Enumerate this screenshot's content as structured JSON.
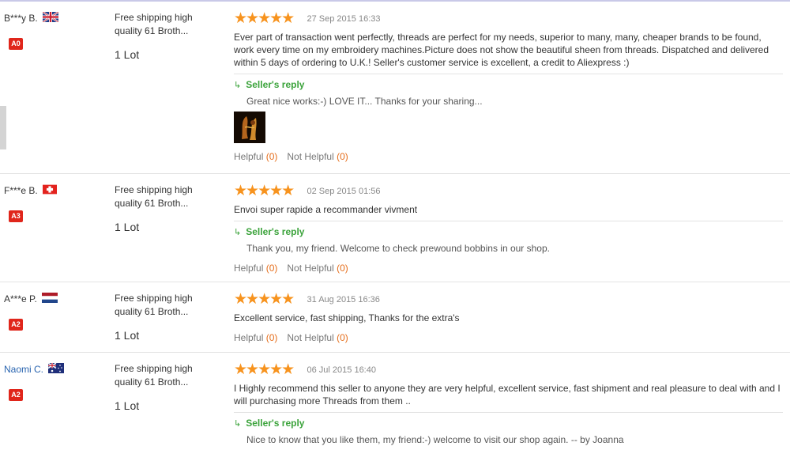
{
  "reviews": [
    {
      "user": "B***y B.",
      "flag": "uk-flag-icon",
      "level": "A0",
      "product": "Free shipping high quality 61 Broth...",
      "quantity": "1 Lot",
      "stars": 5,
      "date": "27 Sep 2015 16:33",
      "comment": "Ever part of transaction went perfectly, threads are perfect for my needs, superior to many, many, cheaper brands to be found, work every time on my embroidery machines.Picture does not show the beautiful sheen from threads. Dispatched and delivered within 5 days of ordering to U.K.! Seller's customer service is excellent, a credit to Aliexpress :)",
      "reply_label": "Seller's reply",
      "reply": "Great nice works:-) LOVE IT... Thanks for your sharing...",
      "helpful_label": "Helpful",
      "helpful_count": "(0)",
      "not_helpful_label": "Not Helpful",
      "not_helpful_count": "(0)"
    },
    {
      "user": "F***e B.",
      "flag": "swiss-flag-icon",
      "level": "A3",
      "product": "Free shipping high quality 61 Broth...",
      "quantity": "1 Lot",
      "stars": 5,
      "date": "02 Sep 2015 01:56",
      "comment": "Envoi super rapide a recommander vivment",
      "reply_label": "Seller's reply",
      "reply": "Thank you, my friend. Welcome to check prewound bobbins in our shop.",
      "helpful_label": "Helpful",
      "helpful_count": "(0)",
      "not_helpful_label": "Not Helpful",
      "not_helpful_count": "(0)"
    },
    {
      "user": "A***e P.",
      "flag": "netherlands-flag-icon",
      "level": "A2",
      "product": "Free shipping high quality 61 Broth...",
      "quantity": "1 Lot",
      "stars": 5,
      "date": "31 Aug 2015 16:36",
      "comment": "Excellent service, fast shipping, Thanks for the extra's",
      "helpful_label": "Helpful",
      "helpful_count": "(0)",
      "not_helpful_label": "Not Helpful",
      "not_helpful_count": "(0)"
    },
    {
      "user": "Naomi C.",
      "flag": "australia-flag-icon",
      "level": "A2",
      "product": "Free shipping high quality 61 Broth...",
      "quantity": "1 Lot",
      "stars": 5,
      "date": "06 Jul 2015 16:40",
      "comment": "I Highly recommend this seller to anyone they are very helpful, excellent service, fast shipment and real pleasure to deal with and I will purchasing more Threads from them ..",
      "reply_label": "Seller's reply",
      "reply": "Nice to know that you like them, my friend:-) welcome to visit our shop again. -- by Joanna"
    }
  ],
  "colors": {
    "star": "#f7931e",
    "badge": "#e0261b",
    "reply_green": "#3ba33b",
    "count_orange": "#e56d1a",
    "user_link": "#2a65b0"
  }
}
